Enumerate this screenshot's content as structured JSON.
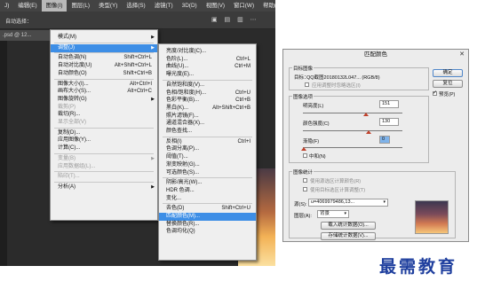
{
  "app": {
    "menubar": [
      "J)",
      "编辑(E)",
      "图像(I)",
      "图层(L)",
      "类型(Y)",
      "选择(S)",
      "滤镜(T)",
      "3D(D)",
      "视图(V)",
      "窗口(W)",
      "帮助(H)"
    ],
    "active_menu_index": 2,
    "options_bar": {
      "auto_select": "自动选择：",
      "glyphs": "▣ ▤ ▥ ⋯"
    },
    "doc_tab": ".psd @ 12..."
  },
  "image_menu": {
    "items": [
      {
        "label": "模式(M)",
        "shortcut": "",
        "arrow": true,
        "disabled": false
      },
      {
        "sep": true
      },
      {
        "label": "调整(J)",
        "shortcut": "",
        "arrow": true,
        "disabled": false,
        "highlight": true
      },
      {
        "sep": true
      },
      {
        "label": "自动色调(N)",
        "shortcut": "Shift+Ctrl+L",
        "disabled": false
      },
      {
        "label": "自动对比度(U)",
        "shortcut": "Alt+Shift+Ctrl+L",
        "disabled": false
      },
      {
        "label": "自动颜色(O)",
        "shortcut": "Shift+Ctrl+B",
        "disabled": false
      },
      {
        "sep": true
      },
      {
        "label": "图像大小(I)...",
        "shortcut": "Alt+Ctrl+I",
        "disabled": false
      },
      {
        "label": "画布大小(S)...",
        "shortcut": "Alt+Ctrl+C",
        "disabled": false
      },
      {
        "label": "图像旋转(G)",
        "shortcut": "",
        "arrow": true,
        "disabled": false
      },
      {
        "label": "裁剪(P)",
        "shortcut": "",
        "disabled": true
      },
      {
        "label": "裁切(R)...",
        "shortcut": "",
        "disabled": false
      },
      {
        "label": "显示全部(V)",
        "shortcut": "",
        "disabled": true
      },
      {
        "sep": true
      },
      {
        "label": "复制(D)...",
        "shortcut": "",
        "disabled": false
      },
      {
        "label": "应用图像(Y)...",
        "shortcut": "",
        "disabled": false
      },
      {
        "label": "计算(C)...",
        "shortcut": "",
        "disabled": false
      },
      {
        "sep": true
      },
      {
        "label": "变量(B)",
        "shortcut": "",
        "arrow": true,
        "disabled": true
      },
      {
        "label": "应用数据组(L)...",
        "shortcut": "",
        "disabled": true
      },
      {
        "sep": true
      },
      {
        "label": "陷印(T)...",
        "shortcut": "",
        "disabled": true
      },
      {
        "sep": true
      },
      {
        "label": "分析(A)",
        "shortcut": "",
        "arrow": true,
        "disabled": false
      }
    ]
  },
  "adjust_menu": {
    "items": [
      {
        "label": "亮度/对比度(C)...",
        "shortcut": ""
      },
      {
        "label": "色阶(L)...",
        "shortcut": "Ctrl+L"
      },
      {
        "label": "曲线(U)...",
        "shortcut": "Ctrl+M"
      },
      {
        "label": "曝光度(E)...",
        "shortcut": ""
      },
      {
        "sep": true
      },
      {
        "label": "自然饱和度(V)...",
        "shortcut": ""
      },
      {
        "label": "色相/饱和度(H)...",
        "shortcut": "Ctrl+U"
      },
      {
        "label": "色彩平衡(B)...",
        "shortcut": "Ctrl+B"
      },
      {
        "label": "黑白(K)...",
        "shortcut": "Alt+Shift+Ctrl+B"
      },
      {
        "label": "照片滤镜(F)...",
        "shortcut": ""
      },
      {
        "label": "通道混合器(X)...",
        "shortcut": ""
      },
      {
        "label": "颜色查找...",
        "shortcut": ""
      },
      {
        "sep": true
      },
      {
        "label": "反相(I)",
        "shortcut": "Ctrl+I"
      },
      {
        "label": "色调分离(P)...",
        "shortcut": ""
      },
      {
        "label": "阈值(T)...",
        "shortcut": ""
      },
      {
        "label": "渐变映射(G)...",
        "shortcut": ""
      },
      {
        "label": "可选颜色(S)...",
        "shortcut": ""
      },
      {
        "sep": true
      },
      {
        "label": "阴影/高光(W)...",
        "shortcut": ""
      },
      {
        "label": "HDR 色调...",
        "shortcut": ""
      },
      {
        "label": "变化...",
        "shortcut": ""
      },
      {
        "sep": true
      },
      {
        "label": "去色(D)",
        "shortcut": "Shift+Ctrl+U"
      },
      {
        "label": "匹配颜色(M)...",
        "shortcut": "",
        "highlight": true
      },
      {
        "label": "替换颜色(R)...",
        "shortcut": ""
      },
      {
        "label": "色调均化(Q)",
        "shortcut": ""
      }
    ]
  },
  "dialog": {
    "title": "匹配颜色",
    "close": "✕",
    "target_group": "目标图像",
    "target_label": "目标：",
    "target_value": "QQ截图20180132L047... (RGB/8)",
    "ignore_selection": "应用调整时忽略选区(I)",
    "options_group": "图像选项",
    "luminance_label": "明亮度(L)",
    "luminance_value": "151",
    "intensity_label": "颜色强度(C)",
    "intensity_value": "130",
    "fade_label": "渐隐(F)",
    "fade_value": "0",
    "neutralize": "中和(N)",
    "stats_group": "图像统计",
    "use_sel_source": "使用源选区计算颜色(R)",
    "use_sel_target": "使用目标选区计算调整(T)",
    "source_label": "源(S):",
    "source_value": "u=4069979486,13...",
    "layer_label": "图层(A):",
    "layer_value": "背景",
    "load_btn": "载入统计数据(O)...",
    "save_btn": "存储统计数据(V)...",
    "ok": "确定",
    "reset": "复位",
    "preview": "预览(P)",
    "preview_checked": true
  },
  "watermark": "最需教育"
}
